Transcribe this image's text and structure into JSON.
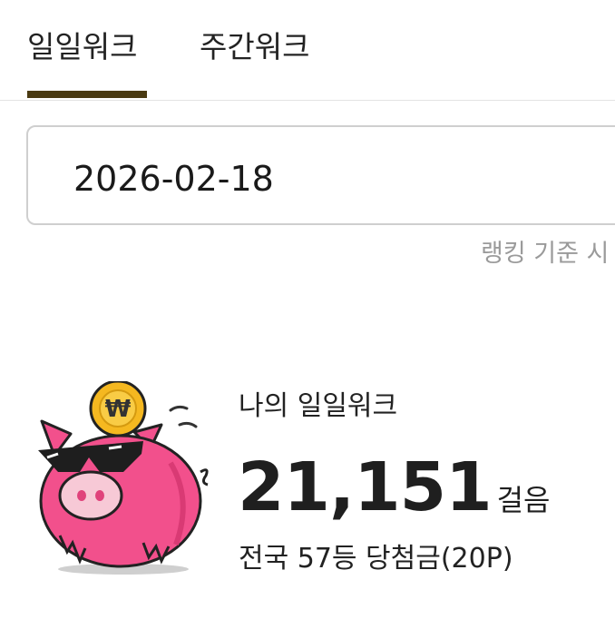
{
  "tabs": [
    {
      "label": "일일워크",
      "selected": true
    },
    {
      "label": "주간워크",
      "selected": false
    }
  ],
  "colors": {
    "tab_indicator": "#4a3a12",
    "pig_pink": "#f2508c",
    "coin_gold": "#f5b820",
    "muted_text": "#9a9a9a"
  },
  "date_field": {
    "value": "2026-02-18"
  },
  "ranking_note": "랭킹 기준 시",
  "my_walk": {
    "title": "나의 일일워크",
    "steps": "21,151",
    "steps_unit": "걸음",
    "rank_text": "전국 57등 당첨금(20P)"
  },
  "illustration": {
    "icon": "piggy-bank-with-sunglasses-and-coin",
    "coin_symbol": "₩"
  }
}
